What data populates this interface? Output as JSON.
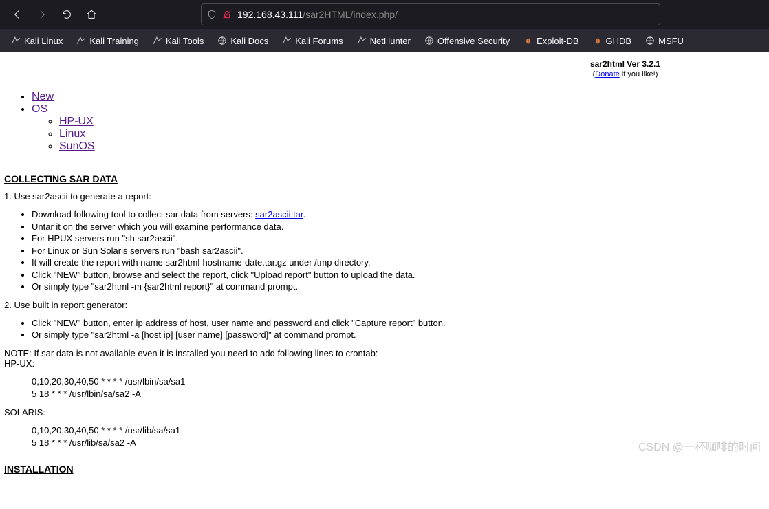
{
  "url": {
    "host": "192.168.43.111",
    "path": "/sar2HTML/index.php/"
  },
  "bookmarks": [
    {
      "label": "Kali Linux",
      "icon": "dragon"
    },
    {
      "label": "Kali Training",
      "icon": "dragon"
    },
    {
      "label": "Kali Tools",
      "icon": "dragon"
    },
    {
      "label": "Kali Docs",
      "icon": "globe"
    },
    {
      "label": "Kali Forums",
      "icon": "dragon"
    },
    {
      "label": "NetHunter",
      "icon": "dragon"
    },
    {
      "label": "Offensive Security",
      "icon": "globe"
    },
    {
      "label": "Exploit-DB",
      "icon": "bug"
    },
    {
      "label": "GHDB",
      "icon": "bug"
    },
    {
      "label": "MSFU",
      "icon": "globe"
    }
  ],
  "banner": {
    "title": "sar2html Ver 3.2.1",
    "donate": "Donate",
    "suffix": " if you like!)"
  },
  "nav": {
    "new": "New",
    "os": "OS",
    "os_items": [
      "HP-UX",
      "Linux",
      "SunOS"
    ]
  },
  "s1": {
    "header": "COLLECTING SAR DATA",
    "p1": "1. Use sar2ascii to generate a report:",
    "list1_pre": "Download following tool to collect sar data from servers: ",
    "list1_link": "sar2ascii.tar",
    "list1": [
      "Untar it on the server which you will examine performance data.",
      "For HPUX servers run \"sh sar2ascii\".",
      "For Linux or Sun Solaris servers run \"bash sar2ascii\".",
      "It will create the report with name sar2html-hostname-date.tar.gz under /tmp directory.",
      "Click \"NEW\" button, browse and select the report, click \"Upload report\" button to upload the data.",
      "Or simply type \"sar2html -m {sar2html report}\" at command prompt."
    ],
    "p2": "2. Use built in report generator:",
    "list2": [
      "Click \"NEW\" button, enter ip address of host, user name and password and click \"Capture report\" button.",
      "Or simply type \"sar2html -a [host ip] [user name] [password]\" at command prompt."
    ],
    "note": "NOTE: If sar data is not available even it is installed you need to add following lines to crontab:",
    "hpux_label": "HP-UX:",
    "hpux_cron1": "0,10,20,30,40,50 * * * * /usr/lbin/sa/sa1",
    "hpux_cron2": "5 18 * * * /usr/lbin/sa/sa2 -A",
    "solaris_label": "SOLARIS:",
    "solaris_cron1": "0,10,20,30,40,50 * * * * /usr/lib/sa/sa1",
    "solaris_cron2": "5 18 * * * /usr/lib/sa/sa2 -A"
  },
  "s2": {
    "header": "INSTALLATION"
  },
  "watermark": "CSDN @一杯咖啡的时间"
}
